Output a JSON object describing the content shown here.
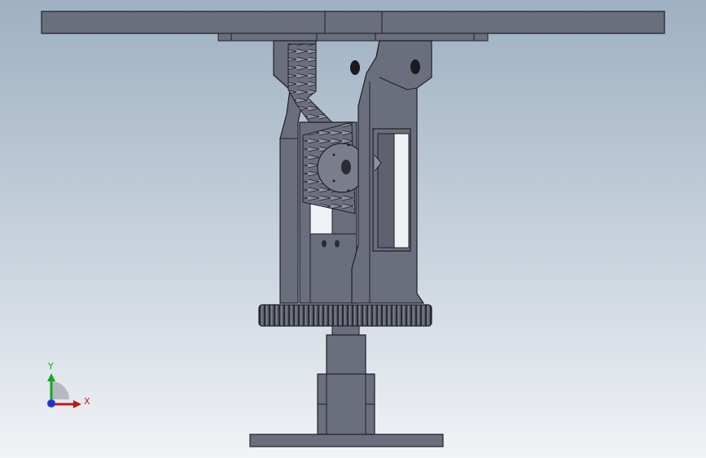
{
  "colors": {
    "viewport_top": "#9eb0c2",
    "viewport_bottom": "#f1f3f6",
    "part_face": "#6b6f7d",
    "part_dark": "#4e5260",
    "part_light": "#8b8f9c",
    "edge": "#1e1f26",
    "axis_x": "#c0181c",
    "axis_y": "#1aa52a",
    "axis_z": "#2233cc"
  },
  "triad": {
    "x_label": "X",
    "y_label": "Y",
    "x_icon": "x-axis-arrow-icon",
    "y_icon": "y-axis-arrow-icon",
    "z_icon": "z-axis-dot-icon"
  }
}
